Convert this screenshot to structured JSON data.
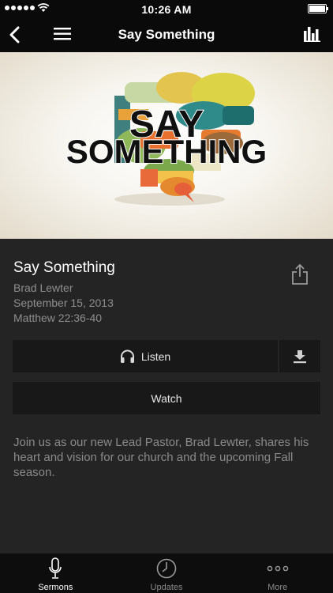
{
  "status_bar": {
    "time": "10:26 AM"
  },
  "nav": {
    "title": "Say Something"
  },
  "hero": {
    "line1": "SAY",
    "line2": "SOMETHING"
  },
  "sermon": {
    "title": "Say Something",
    "speaker": "Brad Lewter",
    "date": "September 15, 2013",
    "passage": "Matthew 22:36-40"
  },
  "actions": {
    "listen_label": "Listen",
    "watch_label": "Watch"
  },
  "description": "Join us as our new Lead Pastor, Brad Lewter, shares his heart and vision for our church and the upcoming Fall season.",
  "tabs": [
    {
      "label": "Sermons",
      "icon": "microphone-icon",
      "active": true
    },
    {
      "label": "Updates",
      "icon": "clock-icon",
      "active": false
    },
    {
      "label": "More",
      "icon": "more-dots-icon",
      "active": false
    }
  ],
  "colors": {
    "background": "#242424",
    "bars": "#0a0a0a",
    "button": "#181818",
    "muted_text": "#8e8e8e"
  }
}
